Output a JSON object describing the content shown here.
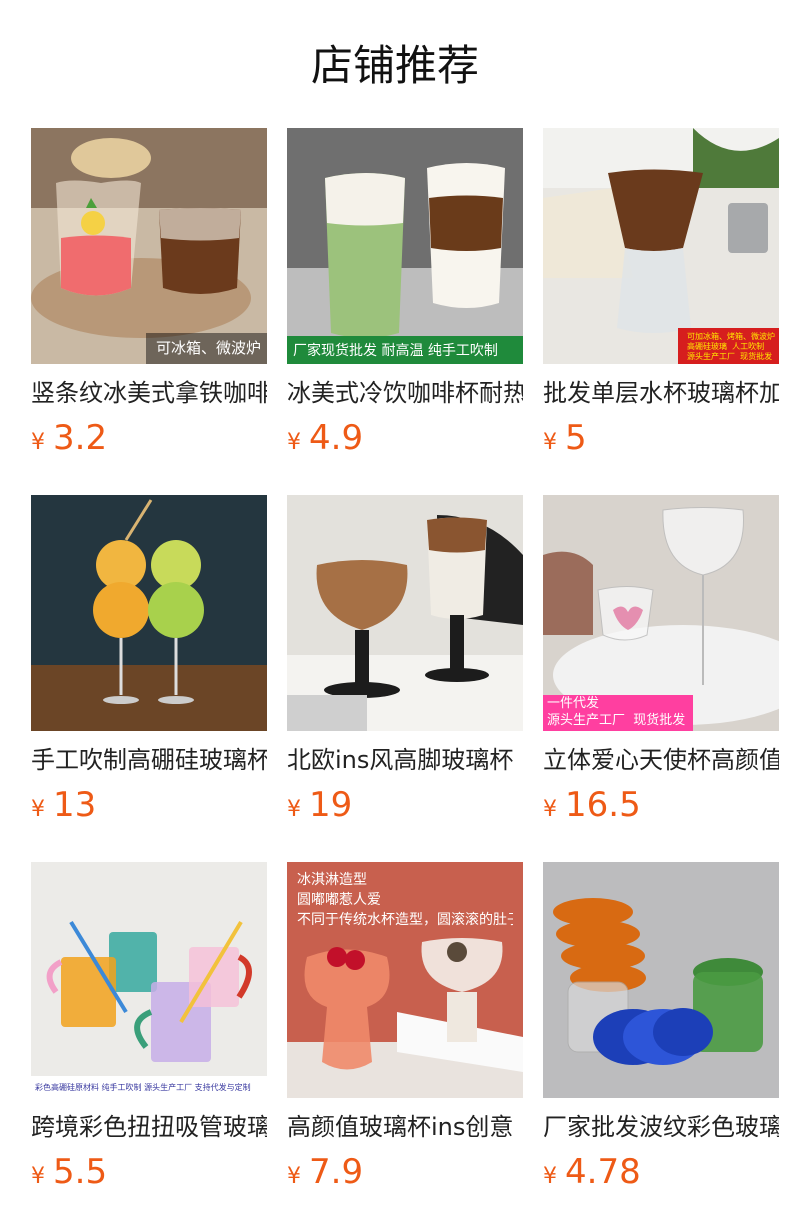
{
  "page": {
    "title": "店铺推荐"
  },
  "currency_symbol": "¥",
  "products": [
    {
      "name": "竖条纹冰美式拿铁咖啡杯",
      "price": "3.2",
      "overlay": "可冰箱、微波炉"
    },
    {
      "name": "冰美式冷饮咖啡杯耐热",
      "price": "4.9",
      "overlay": "厂家现货批发  耐高温  纯手工吹制"
    },
    {
      "name": "批发单层水杯玻璃杯加厚",
      "price": "5",
      "overlay": "可加冰箱、烤箱、微波炉\n高硼硅玻璃  人工吹制\n源头生产工厂  现货批发"
    },
    {
      "name": "手工吹制高硼硅玻璃杯",
      "price": "13",
      "overlay": ""
    },
    {
      "name": "北欧ins风高脚玻璃杯",
      "price": "19",
      "overlay": ""
    },
    {
      "name": "立体爱心天使杯高颜值",
      "price": "16.5",
      "overlay": "一件代发\n源头生产工厂  现货批发"
    },
    {
      "name": "跨境彩色扭扭吸管玻璃杯",
      "price": "5.5",
      "overlay": "彩色高硼硅原材料  纯手工吹制  源头生产工厂  支持代发与定制"
    },
    {
      "name": "高颜值玻璃杯ins创意",
      "price": "7.9",
      "overlay": "冰淇淋造型\n圆嘟嘟惹人爱\n不同于传统水杯造型，圆滚滚的肚子，让人爱不释手"
    },
    {
      "name": "厂家批发波纹彩色玻璃杯",
      "price": "4.78",
      "overlay": ""
    }
  ]
}
